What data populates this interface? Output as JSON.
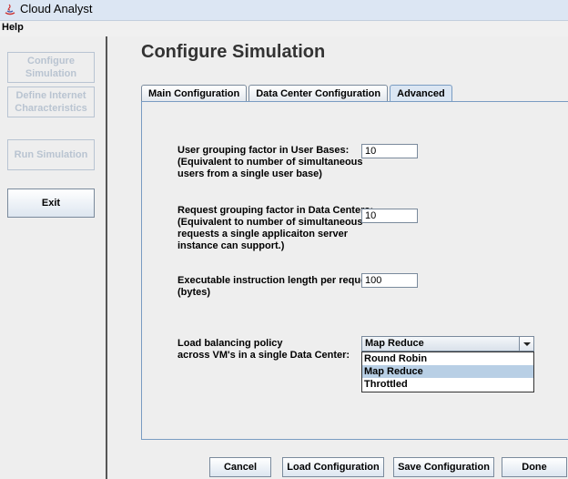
{
  "window": {
    "title": "Cloud Analyst"
  },
  "menu": {
    "help": "Help"
  },
  "sidebar": {
    "configure": "Configure Simulation",
    "internet": "Define Internet Characteristics",
    "run": "Run Simulation",
    "exit": "Exit"
  },
  "main": {
    "title": "Configure Simulation",
    "tabs": [
      "Main Configuration",
      "Data Center Configuration",
      "Advanced"
    ]
  },
  "advanced": {
    "user_grouping": {
      "label1": "User grouping factor in User Bases:",
      "label2": "(Equivalent to number of simultaneous",
      "label3": "users from a single user base)",
      "value": "10"
    },
    "request_grouping": {
      "label1": "Request grouping factor in Data Centers:",
      "label2": "(Equivalent to number of simultaneous",
      "label3": "requests a single applicaiton server",
      "label4": "instance can support.)",
      "value": "10"
    },
    "instruction_length": {
      "label1": "Executable instruction length per request:",
      "label2": "(bytes)",
      "value": "100"
    },
    "load_balancing": {
      "label1": "Load balancing policy",
      "label2": "across VM's in a single Data Center:",
      "selected": "Map Reduce",
      "options": [
        "Round Robin",
        "Map Reduce",
        "Throttled"
      ]
    }
  },
  "buttons": {
    "cancel": "Cancel",
    "load": "Load Configuration",
    "save": "Save Configuration",
    "done": "Done"
  }
}
